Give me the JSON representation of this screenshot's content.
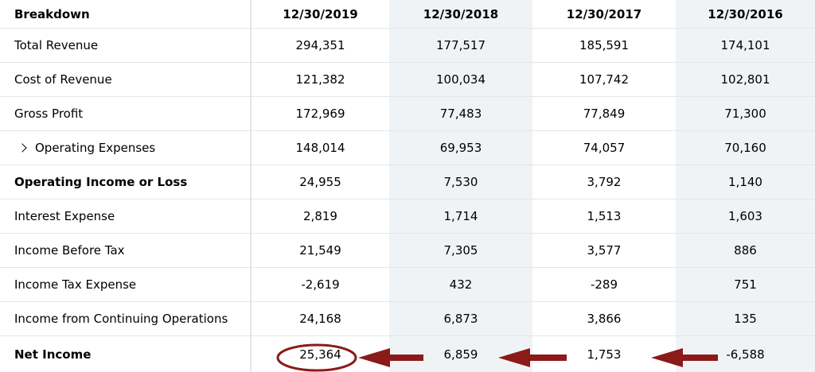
{
  "table": {
    "columns": [
      "Breakdown",
      "12/30/2019",
      "12/30/2018",
      "12/30/2017",
      "12/30/2016"
    ],
    "rows": [
      {
        "label": "Total Revenue",
        "values": [
          "294,351",
          "177,517",
          "185,591",
          "174,101"
        ]
      },
      {
        "label": "Cost of Revenue",
        "values": [
          "121,382",
          "100,034",
          "107,742",
          "102,801"
        ]
      },
      {
        "label": "Gross Profit",
        "values": [
          "172,969",
          "77,483",
          "77,849",
          "71,300"
        ]
      },
      {
        "label": "Operating Expenses",
        "values": [
          "148,014",
          "69,953",
          "74,057",
          "70,160"
        ]
      },
      {
        "label": "Operating Income or Loss",
        "values": [
          "24,955",
          "7,530",
          "3,792",
          "1,140"
        ]
      },
      {
        "label": "Interest Expense",
        "values": [
          "2,819",
          "1,714",
          "1,513",
          "1,603"
        ]
      },
      {
        "label": "Income Before Tax",
        "values": [
          "21,549",
          "7,305",
          "3,577",
          "886"
        ]
      },
      {
        "label": "Income Tax Expense",
        "values": [
          "-2,619",
          "432",
          "-289",
          "751"
        ]
      },
      {
        "label": "Income from Continuing Operations",
        "values": [
          "24,168",
          "6,873",
          "3,866",
          "135"
        ]
      },
      {
        "label": "Net Income",
        "values": [
          "25,364",
          "6,859",
          "1,753",
          "-6,588"
        ]
      }
    ]
  },
  "colors": {
    "annotation": "#8b1a1a",
    "shade": "#f0f3f5",
    "grid": "#e3e6ea"
  },
  "icons": {
    "expand": "chevron-right-icon"
  }
}
